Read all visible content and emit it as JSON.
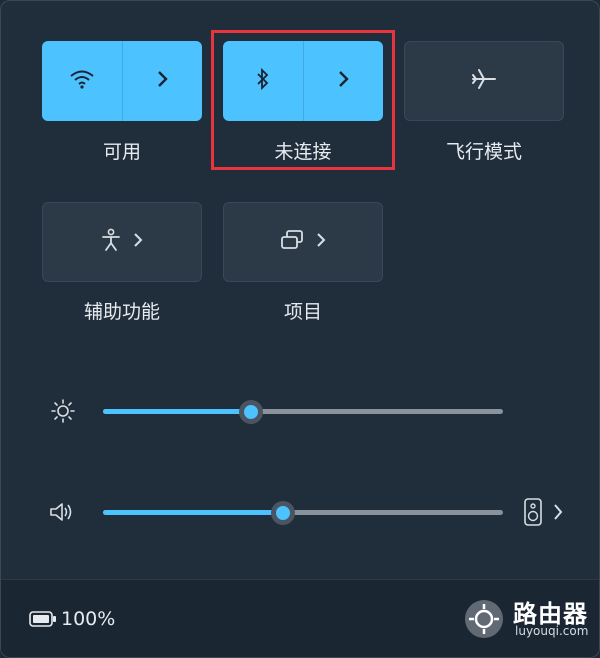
{
  "quick_settings": {
    "tiles": [
      {
        "id": "wifi",
        "label": "可用",
        "icon": "wifi-icon",
        "active": true
      },
      {
        "id": "bluetooth",
        "label": "未连接",
        "icon": "bluetooth-icon",
        "active": true
      },
      {
        "id": "airplane",
        "label": "飞行模式",
        "icon": "airplane-icon",
        "active": false
      },
      {
        "id": "accessibility",
        "label": "辅助功能",
        "icon": "accessibility-icon",
        "active": false
      },
      {
        "id": "project",
        "label": "项目",
        "icon": "project-icon",
        "active": false
      }
    ],
    "brightness": {
      "icon": "brightness-icon",
      "value": 0.37
    },
    "volume": {
      "icon": "speaker-icon",
      "value": 0.45,
      "output_icon": "speaker-device-icon"
    }
  },
  "footer": {
    "battery_icon": "battery-icon",
    "battery_text": "100%",
    "watermark": {
      "name": "路由器",
      "url": "luyouqi.com"
    }
  },
  "colors": {
    "accent": "#4cc2ff",
    "highlight_box": "#e8343c",
    "panel_bg": "#202d3b"
  }
}
